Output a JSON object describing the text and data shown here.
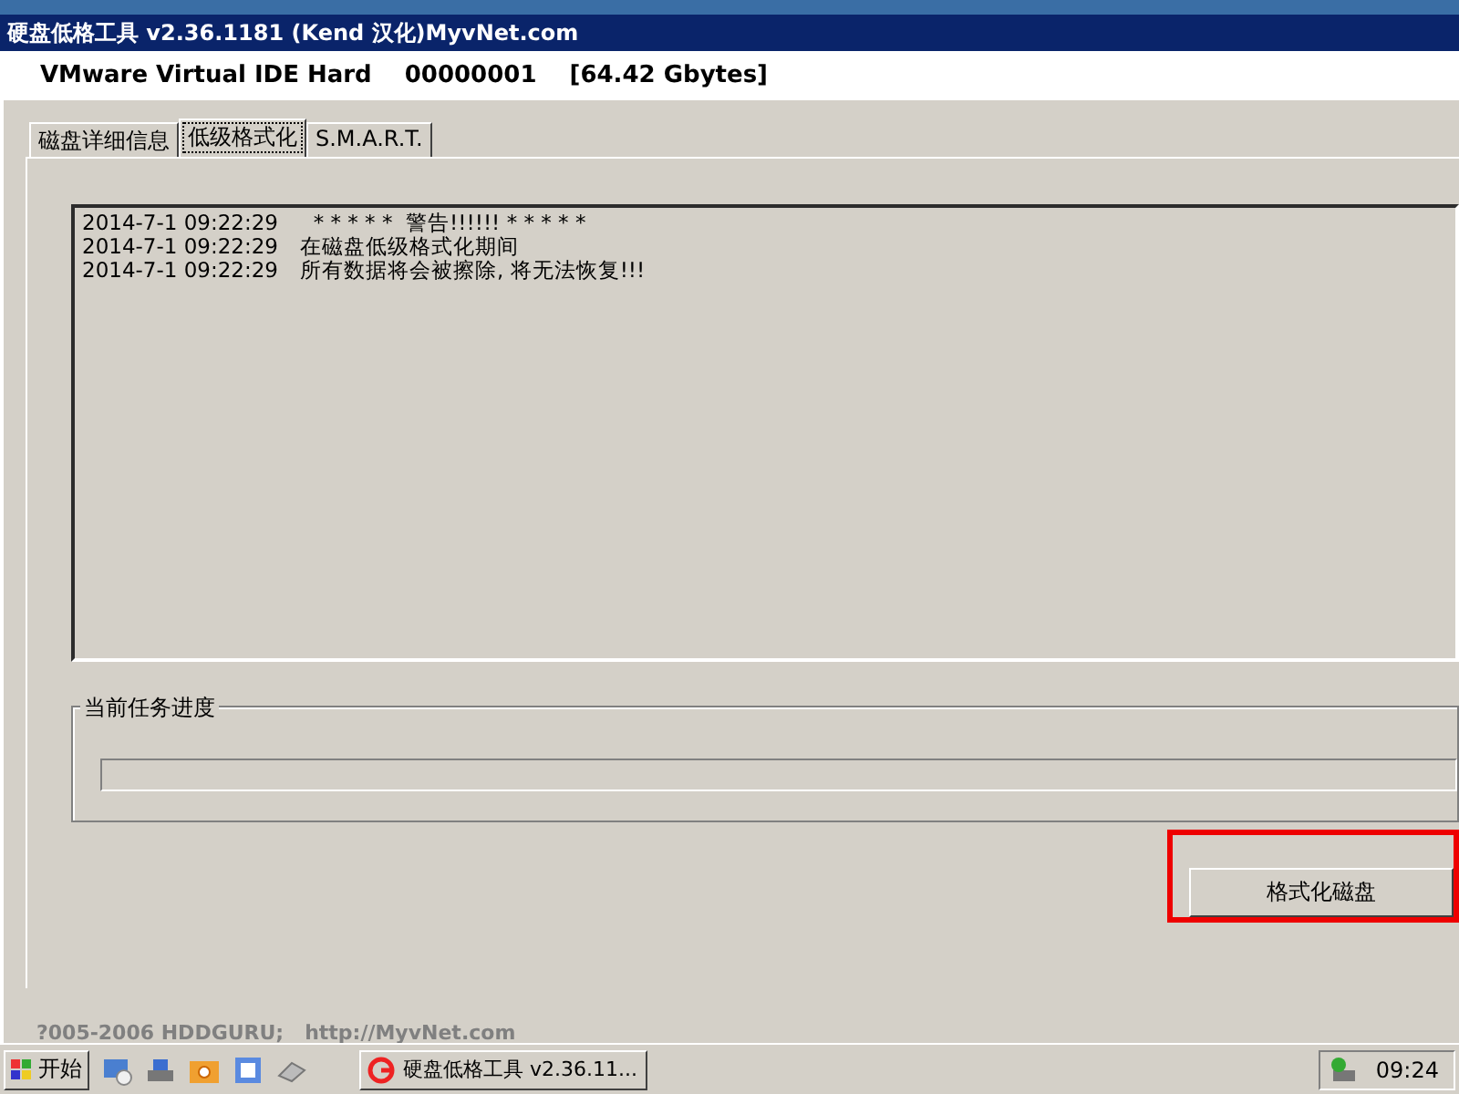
{
  "window": {
    "title": "硬盘低格工具 v2.36.1181 (Kend 汉化)MyvNet.com"
  },
  "device": {
    "model": "VMware Virtual IDE Hard",
    "serial": "00000001",
    "capacity": "[64.42 Gbytes]"
  },
  "tabs": [
    {
      "label": "磁盘详细信息",
      "selected": false
    },
    {
      "label": "低级格式化",
      "selected": true
    },
    {
      "label": "S.M.A.R.T.",
      "selected": false
    }
  ],
  "log": [
    {
      "time": "2014-7-1 09:22:29",
      "message": "  * * * * *  警告!!!!!! * * * * *"
    },
    {
      "time": "2014-7-1 09:22:29",
      "message": "在磁盘低级格式化期间"
    },
    {
      "time": "2014-7-1 09:22:29",
      "message": "所有数据将会被擦除, 将无法恢复!!!"
    }
  ],
  "progress": {
    "title": "当前任务进度",
    "level": 0
  },
  "format_button": {
    "label": "格式化磁盘",
    "highlighted": true
  },
  "footer": "?005-2006 HDDGURU;   http://MyvNet.com",
  "taskbar": {
    "start": "开始",
    "task": "硬盘低格工具 v2.36.11...",
    "clock": "09:24"
  }
}
